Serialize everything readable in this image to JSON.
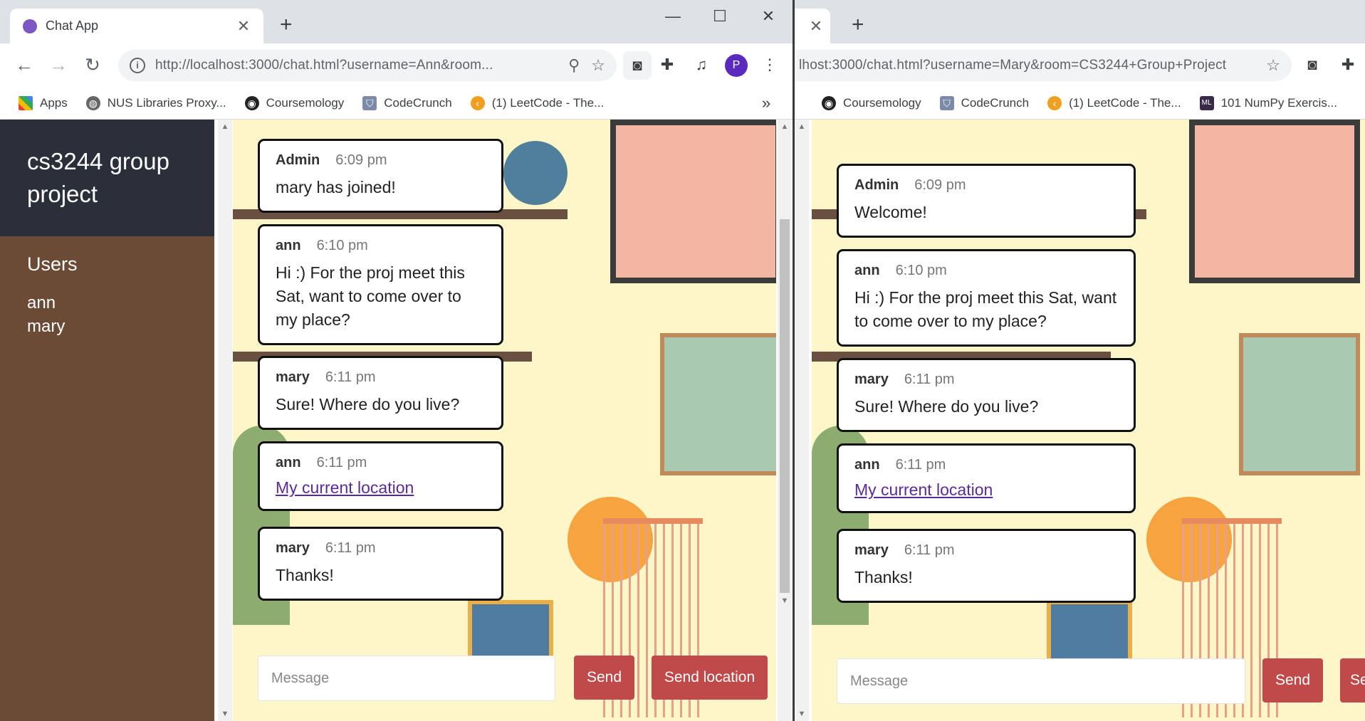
{
  "windows": [
    {
      "tab_title": "Chat App",
      "url": "http://localhost:3000/chat.html?username=Ann&room...",
      "bookmarks": [
        "Apps",
        "NUS Libraries Proxy...",
        "Coursemology",
        "CodeCrunch",
        "(1) LeetCode - The..."
      ],
      "profile_initial": "P",
      "sidebar": {
        "room_title": "cs3244 group project",
        "users_heading": "Users",
        "users": [
          "ann",
          "mary"
        ]
      },
      "messages": [
        {
          "user": "Admin",
          "time": "6:09 pm",
          "text": "mary has joined!"
        },
        {
          "user": "ann",
          "time": "6:10 pm",
          "text": "Hi :) For the proj meet this Sat, want to come over to my place?"
        },
        {
          "user": "mary",
          "time": "6:11 pm",
          "text": "Sure! Where do you live?"
        },
        {
          "user": "ann",
          "time": "6:11 pm",
          "link": "My current location"
        },
        {
          "user": "mary",
          "time": "6:11 pm",
          "text": "Thanks!"
        }
      ],
      "composer": {
        "placeholder": "Message",
        "send_label": "Send",
        "send_location_label": "Send location"
      }
    },
    {
      "url": "lhost:3000/chat.html?username=Mary&room=CS3244+Group+Project",
      "bookmarks": [
        "Coursemology",
        "CodeCrunch",
        "(1) LeetCode - The...",
        "101 NumPy Exercis..."
      ],
      "messages": [
        {
          "user": "Admin",
          "time": "6:09 pm",
          "text": "Welcome!"
        },
        {
          "user": "ann",
          "time": "6:10 pm",
          "text": "Hi :) For the proj meet this Sat, want to come over to my place?"
        },
        {
          "user": "mary",
          "time": "6:11 pm",
          "text": "Sure! Where do you live?"
        },
        {
          "user": "ann",
          "time": "6:11 pm",
          "link": "My current location"
        },
        {
          "user": "mary",
          "time": "6:11 pm",
          "text": "Thanks!"
        }
      ],
      "composer": {
        "placeholder": "Message",
        "send_label": "Send",
        "send_location_label": "Se"
      }
    }
  ],
  "colors": {
    "sidebar_header": "#2b2f3a",
    "sidebar": "#6b4b35",
    "button": "#c04a4a",
    "link": "#5b2b9b",
    "chat_background": "#fdf6c8",
    "tab_icon": "#7e57c2",
    "profile": "#5b2bbf"
  }
}
